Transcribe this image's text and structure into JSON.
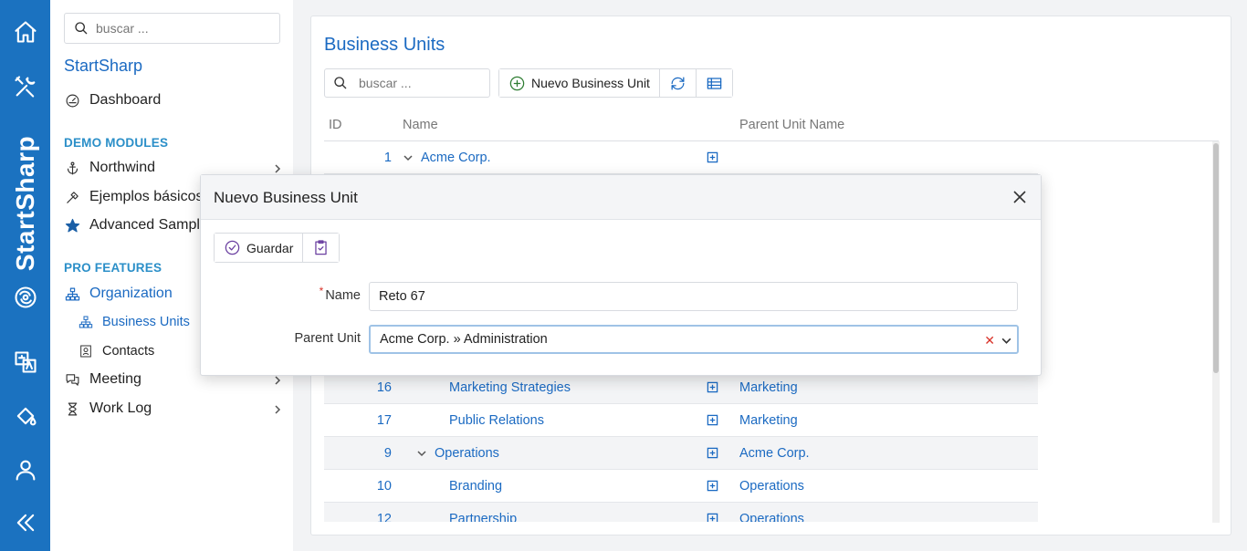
{
  "app": {
    "brand_prefix": "Start",
    "brand_suffix": "Sharp"
  },
  "sidebar": {
    "search_placeholder": "buscar ...",
    "title": "StartSharp",
    "dashboard": "Dashboard",
    "section_demo": "DEMO MODULES",
    "northwind": "Northwind",
    "ejemplos": "Ejemplos básicos",
    "advanced": "Advanced Samples",
    "section_pro": "PRO FEATURES",
    "organization": "Organization",
    "business_units": "Business Units",
    "contacts": "Contacts",
    "meeting": "Meeting",
    "work_log": "Work Log"
  },
  "main": {
    "title": "Business Units",
    "search_placeholder": "buscar ...",
    "new_button": "Nuevo Business Unit",
    "columns": {
      "id": "ID",
      "name": "Name",
      "parent": "Parent Unit Name"
    },
    "rows": [
      {
        "id": "1",
        "name": "Acme Corp.",
        "parent": "",
        "level": 0,
        "expandable": true,
        "alt": false
      },
      {
        "id": "16",
        "name": "Marketing Strategies",
        "parent": "Marketing",
        "level": 2,
        "expandable": false,
        "alt": true
      },
      {
        "id": "17",
        "name": "Public Relations",
        "parent": "Marketing",
        "level": 2,
        "expandable": false,
        "alt": false
      },
      {
        "id": "9",
        "name": "Operations",
        "parent": "Acme Corp.",
        "level": 1,
        "expandable": true,
        "alt": true
      },
      {
        "id": "10",
        "name": "Branding",
        "parent": "Operations",
        "level": 2,
        "expandable": false,
        "alt": false
      },
      {
        "id": "12",
        "name": "Partnership",
        "parent": "Operations",
        "level": 2,
        "expandable": false,
        "alt": true
      }
    ]
  },
  "dialog": {
    "title": "Nuevo Business Unit",
    "save_label": "Guardar",
    "name_label": "Name",
    "name_value": "Reto 67",
    "parent_label": "Parent Unit",
    "parent_value": "Acme Corp. » Administration",
    "clear_glyph": "✕"
  }
}
